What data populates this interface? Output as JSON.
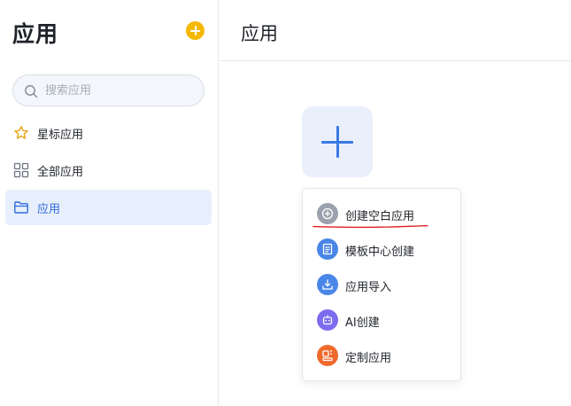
{
  "sidebar": {
    "title": "应用",
    "add_icon": "plus-circle-icon",
    "search": {
      "placeholder": "搜索应用",
      "value": ""
    },
    "items": [
      {
        "label": "星标应用",
        "icon": "star-icon",
        "active": false
      },
      {
        "label": "全部应用",
        "icon": "grid-icon",
        "active": false
      },
      {
        "label": "应用",
        "icon": "folder-icon",
        "active": true
      }
    ]
  },
  "main": {
    "title": "应用",
    "create_tile_icon": "plus-icon",
    "menu": {
      "items": [
        {
          "label": "创建空白应用",
          "icon": "plus-circle-icon",
          "color": "#9aa3ad"
        },
        {
          "label": "模板中心创建",
          "icon": "document-icon",
          "color": "#4a86e8"
        },
        {
          "label": "应用导入",
          "icon": "import-icon",
          "color": "#4a86e8"
        },
        {
          "label": "AI创建",
          "icon": "robot-icon",
          "color": "#7b6cf0"
        },
        {
          "label": "定制应用",
          "icon": "custom-icon",
          "color": "#f06a2d"
        }
      ]
    }
  },
  "colors": {
    "accent": "#2f6bdf",
    "add_button": "#f5b800",
    "active_bg": "#e8effc",
    "annotation_underline": "#e02020"
  }
}
